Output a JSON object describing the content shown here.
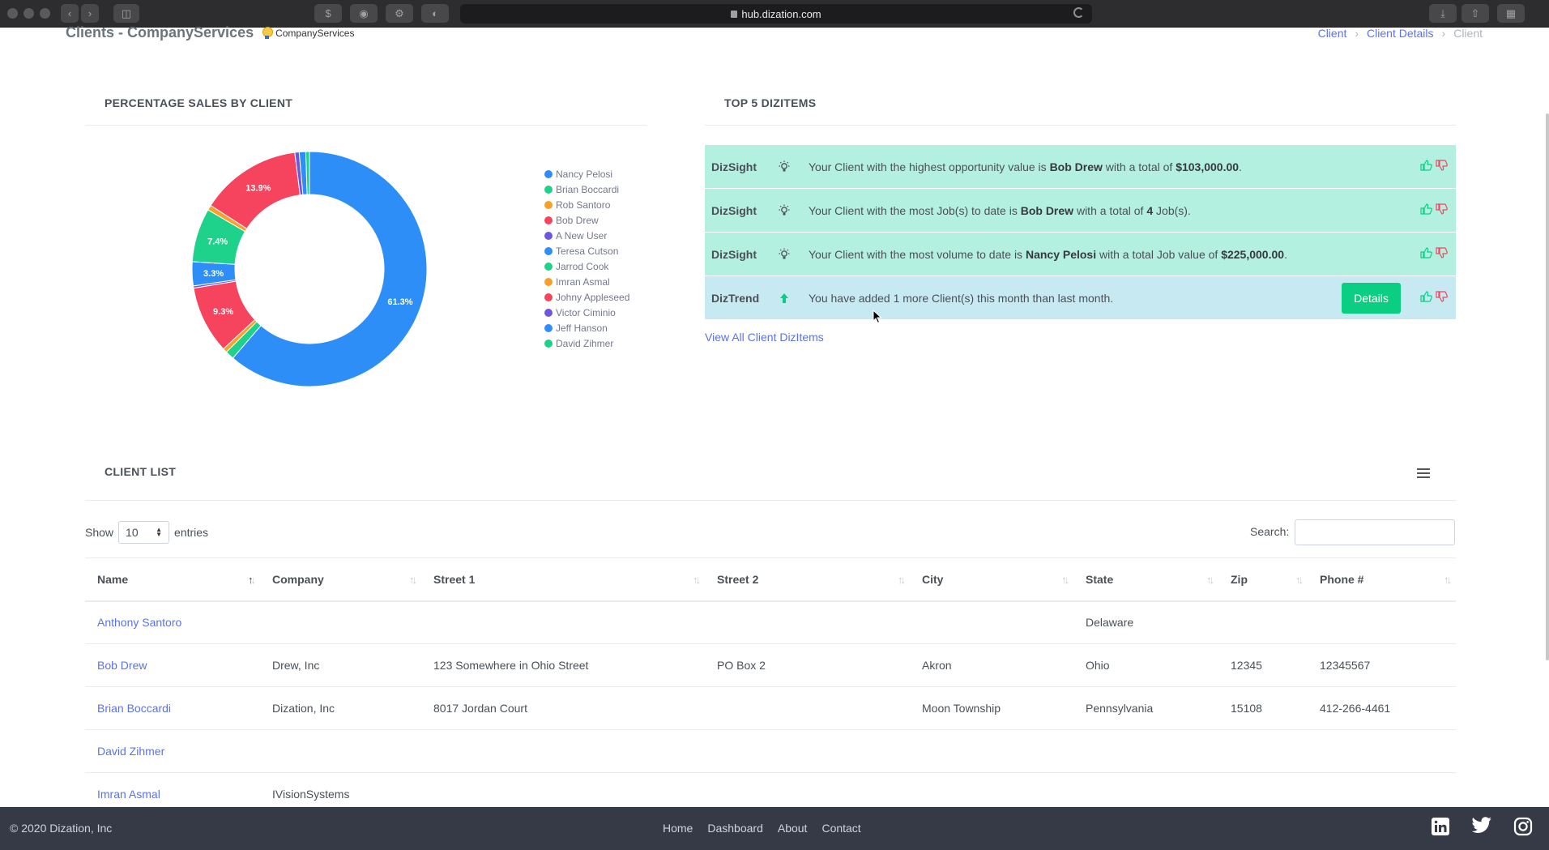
{
  "browser": {
    "url": "hub.dization.com"
  },
  "header": {
    "title": "Clients - CompanyServices",
    "logo_text": "CompanyServices",
    "breadcrumb": [
      "Client",
      "Client Details",
      "Client"
    ]
  },
  "sales_card": {
    "title": "PERCENTAGE SALES BY CLIENT"
  },
  "chart_data": {
    "type": "pie",
    "labels": [
      "Nancy Pelosi",
      "Brian Boccardi",
      "Rob Santoro",
      "Bob Drew",
      "A New User",
      "Teresa Cutson",
      "Jarrod Cook",
      "Imran Asmal",
      "Johny Appleseed",
      "Victor Ciminio",
      "Jeff Hanson",
      "David Zihmer"
    ],
    "values": [
      61.3,
      1.2,
      0.6,
      9.3,
      0.3,
      3.3,
      7.4,
      0.7,
      13.9,
      0.6,
      0.9,
      0.5
    ],
    "colors": [
      "#2e8ef7",
      "#1fd28c",
      "#f7a02a",
      "#f6435e",
      "#6f55e0",
      "#2e8ef7",
      "#1fd28c",
      "#f7a02a",
      "#f6435e",
      "#6f55e0",
      "#2e8ef7",
      "#1fd28c"
    ],
    "slice_labels": [
      "61.3%",
      "9.3%",
      "3.3%",
      "7.4%",
      "13.9%"
    ],
    "legend_position": "right",
    "donut": true
  },
  "dizitems": {
    "title": "TOP 5 DIZITEMS",
    "items": [
      {
        "type": "DizSight",
        "icon": "lightbulb-icon",
        "pre": "Your Client with the highest opportunity value is ",
        "bold1": "Bob Drew",
        "mid": " with a total of ",
        "bold2": "$103,000.00",
        "post": "."
      },
      {
        "type": "DizSight",
        "icon": "lightbulb-icon",
        "pre": "Your Client with the most Job(s) to date is ",
        "bold1": "Bob Drew",
        "mid": " with a total of ",
        "bold2": "4",
        "post": " Job(s)."
      },
      {
        "type": "DizSight",
        "icon": "lightbulb-icon",
        "pre": "Your Client with the most volume to date is ",
        "bold1": "Nancy Pelosi",
        "mid": " with a total Job value of ",
        "bold2": "$225,000.00",
        "post": "."
      },
      {
        "type": "DizTrend",
        "icon": "arrow-up-icon",
        "pre": "You have added 1 more Client(s) this month than last month.",
        "details_label": "Details"
      }
    ],
    "view_all": "View All Client DizItems"
  },
  "client_list": {
    "title": "CLIENT LIST",
    "show_label": "Show",
    "entries_value": "10",
    "entries_label": "entries",
    "search_label": "Search:",
    "columns": [
      "Name",
      "Company",
      "Street 1",
      "Street 2",
      "City",
      "State",
      "Zip",
      "Phone #"
    ],
    "rows": [
      [
        "Anthony Santoro",
        "",
        "",
        "",
        "",
        "Delaware",
        "",
        ""
      ],
      [
        "Bob Drew",
        "Drew, Inc",
        "123 Somewhere in Ohio Street",
        "PO Box 2",
        "Akron",
        "Ohio",
        "12345",
        "12345567"
      ],
      [
        "Brian Boccardi",
        "Dization, Inc",
        "8017 Jordan Court",
        "",
        "Moon Township",
        "Pennsylvania",
        "15108",
        "412-266-4461"
      ],
      [
        "David Zihmer",
        "",
        "",
        "",
        "",
        "",
        "",
        ""
      ],
      [
        "Imran Asmal",
        "IVisionSystems",
        "",
        "",
        "",
        "",
        "",
        ""
      ]
    ]
  },
  "footer": {
    "copyright": "© 2020 Dization, Inc",
    "links": [
      "Home",
      "Dashboard",
      "About",
      "Contact"
    ]
  },
  "colors": {
    "accent": "#5b73e8",
    "success": "#0acf83",
    "sight_bg": "#b4f0e0",
    "trend_bg": "#c6e9f2",
    "footer_bg": "#363a47"
  }
}
